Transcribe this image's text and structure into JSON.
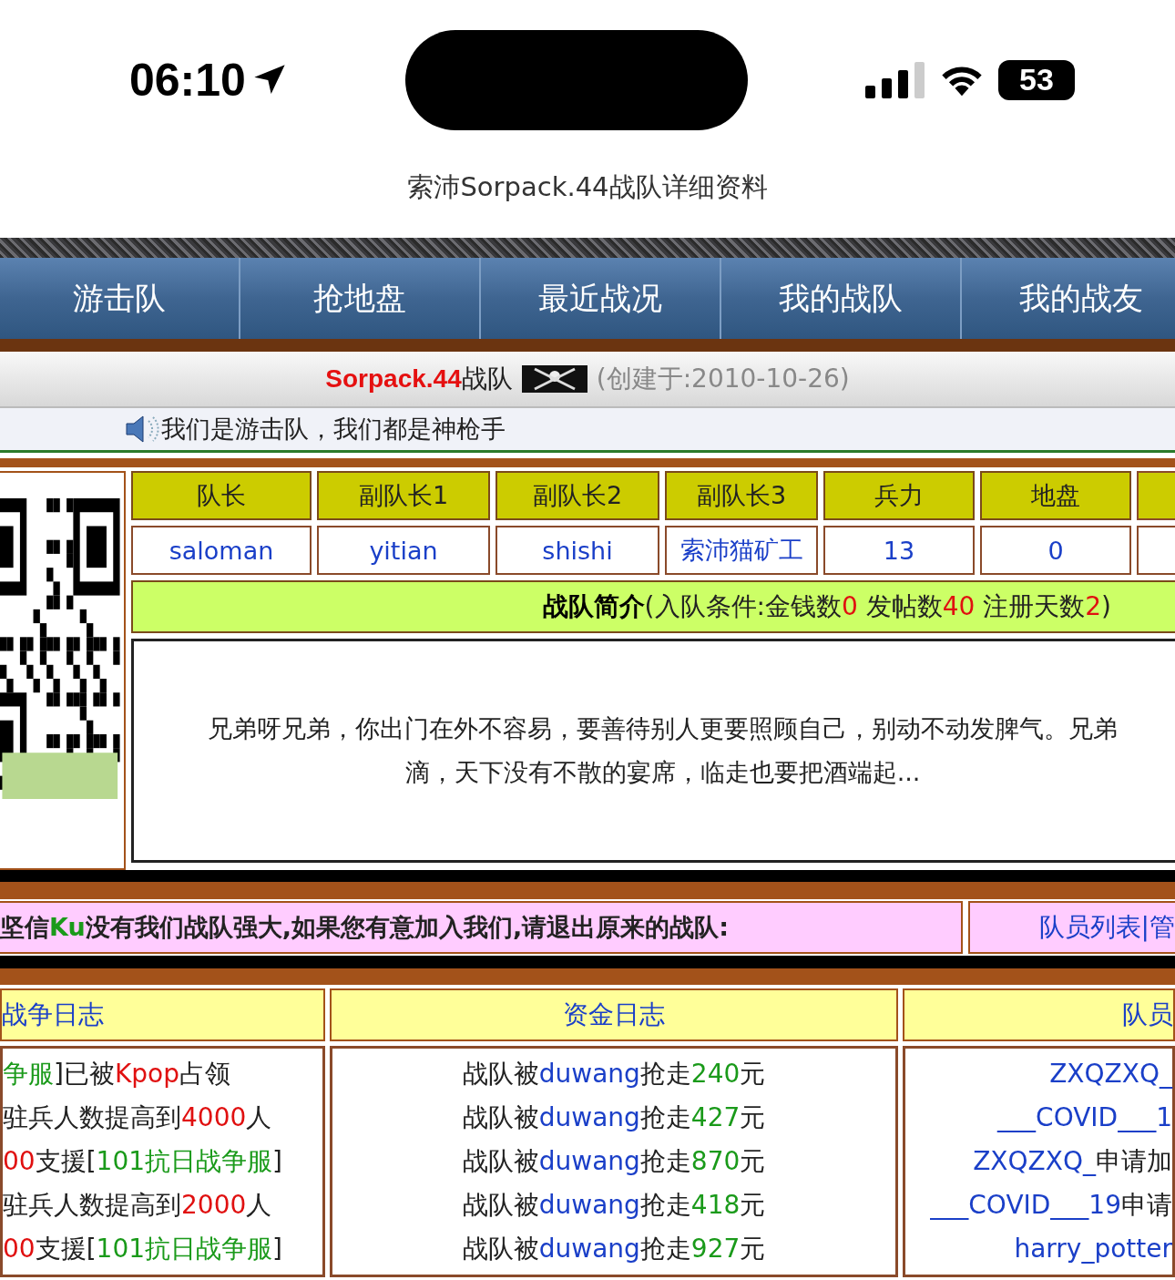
{
  "status_bar": {
    "time": "06:10",
    "battery": "53"
  },
  "page_title": "索沛Sorpack.44战队详细资料",
  "nav_tabs": [
    {
      "label": "游击队"
    },
    {
      "label": "抢地盘"
    },
    {
      "label": "最近战况"
    },
    {
      "label": "我的战队"
    },
    {
      "label": "我的战友"
    }
  ],
  "team_header": {
    "name": "Sorpack.44",
    "suffix": "战队",
    "created": "(创建于:2010-10-26)"
  },
  "motto": "我们是游击队，我们都是神枪手",
  "officers": {
    "columns": [
      "队长",
      "副队长1",
      "副队长2",
      "副队长3",
      "兵力",
      "地盘"
    ],
    "values": [
      "saloman",
      "yitian",
      "shishi",
      "索沛猫矿工",
      "13",
      "0"
    ]
  },
  "intro": {
    "title": "战队简介",
    "segments": [
      {
        "kind": "plain",
        "text": "(入队条件:金钱数"
      },
      {
        "kind": "red",
        "text": "0"
      },
      {
        "kind": "plain",
        "text": " 发帖数"
      },
      {
        "kind": "red",
        "text": "40"
      },
      {
        "kind": "plain",
        "text": " 注册天数"
      },
      {
        "kind": "red",
        "text": "2"
      },
      {
        "kind": "plain",
        "text": ")"
      }
    ],
    "lines": [
      "兄弟呀兄弟，你出门在外不容易，要善待别人更要照顾自己，别动不动发脾气。兄弟",
      "滴，天下没有不散的宴席，临走也要把酒端起..."
    ]
  },
  "recruit": {
    "segments": [
      {
        "kind": "plain",
        "text": "坚信"
      },
      {
        "kind": "green",
        "text": "Ku"
      },
      {
        "kind": "plain",
        "text": "没有我们战队强大,如果您有意加入我们,请退出原来的战队:"
      }
    ],
    "link": "队员列表|管"
  },
  "logs": [
    {
      "title": "战争日志",
      "rows": [
        [
          {
            "kind": "green",
            "text": "争服"
          },
          {
            "kind": "plain",
            "text": "]已被"
          },
          {
            "kind": "red",
            "text": "Kpop"
          },
          {
            "kind": "plain",
            "text": "占领"
          }
        ],
        [
          {
            "kind": "plain",
            "text": "驻兵人数提高到"
          },
          {
            "kind": "red",
            "text": "4000"
          },
          {
            "kind": "plain",
            "text": "人"
          }
        ],
        [
          {
            "kind": "red",
            "text": "00"
          },
          {
            "kind": "plain",
            "text": "支援["
          },
          {
            "kind": "green",
            "text": "101抗日战争服"
          },
          {
            "kind": "plain",
            "text": "]"
          }
        ],
        [
          {
            "kind": "plain",
            "text": "驻兵人数提高到"
          },
          {
            "kind": "red",
            "text": "2000"
          },
          {
            "kind": "plain",
            "text": "人"
          }
        ],
        [
          {
            "kind": "red",
            "text": "00"
          },
          {
            "kind": "plain",
            "text": "支援["
          },
          {
            "kind": "green",
            "text": "101抗日战争服"
          },
          {
            "kind": "plain",
            "text": "]"
          }
        ]
      ]
    },
    {
      "title": "资金日志",
      "rows": [
        [
          {
            "kind": "plain",
            "text": "战队被"
          },
          {
            "kind": "blue",
            "text": "duwang"
          },
          {
            "kind": "plain",
            "text": "抢走"
          },
          {
            "kind": "green",
            "text": "240"
          },
          {
            "kind": "plain",
            "text": "元"
          }
        ],
        [
          {
            "kind": "plain",
            "text": "战队被"
          },
          {
            "kind": "blue",
            "text": "duwang"
          },
          {
            "kind": "plain",
            "text": "抢走"
          },
          {
            "kind": "green",
            "text": "427"
          },
          {
            "kind": "plain",
            "text": "元"
          }
        ],
        [
          {
            "kind": "plain",
            "text": "战队被"
          },
          {
            "kind": "blue",
            "text": "duwang"
          },
          {
            "kind": "plain",
            "text": "抢走"
          },
          {
            "kind": "green",
            "text": "870"
          },
          {
            "kind": "plain",
            "text": "元"
          }
        ],
        [
          {
            "kind": "plain",
            "text": "战队被"
          },
          {
            "kind": "blue",
            "text": "duwang"
          },
          {
            "kind": "plain",
            "text": "抢走"
          },
          {
            "kind": "green",
            "text": "418"
          },
          {
            "kind": "plain",
            "text": "元"
          }
        ],
        [
          {
            "kind": "plain",
            "text": "战队被"
          },
          {
            "kind": "blue",
            "text": "duwang"
          },
          {
            "kind": "plain",
            "text": "抢走"
          },
          {
            "kind": "green",
            "text": "927"
          },
          {
            "kind": "plain",
            "text": "元"
          }
        ]
      ]
    },
    {
      "title": "队员",
      "rows": [
        [
          {
            "kind": "blue",
            "text": "ZXQZXQ_"
          }
        ],
        [
          {
            "kind": "blue",
            "text": "___COVID___1"
          }
        ],
        [
          {
            "kind": "blue",
            "text": "ZXQZXQ_"
          },
          {
            "kind": "plain",
            "text": "申请加"
          }
        ],
        [
          {
            "kind": "blue",
            "text": "___COVID___19"
          },
          {
            "kind": "plain",
            "text": "申请"
          }
        ],
        [
          {
            "kind": "blue",
            "text": "harry_potter"
          }
        ]
      ]
    }
  ]
}
